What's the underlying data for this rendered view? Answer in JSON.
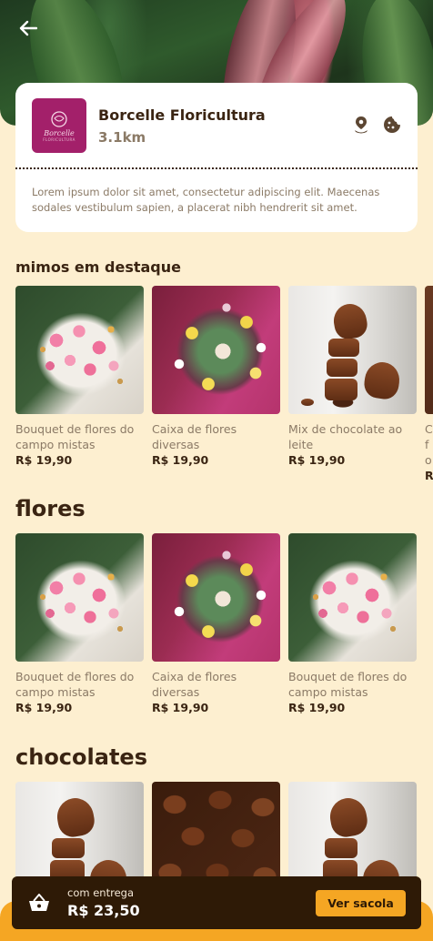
{
  "store": {
    "name": "Borcelle Floricultura",
    "distance": "3.1km",
    "logo_text": "Borcelle",
    "logo_sub": "FLORICULTURA",
    "description": "Lorem ipsum dolor sit amet, consectetur adipiscing elit. Maecenas sodales vestibulum sapien, a placerat nibh hendrerit sit amet."
  },
  "sections": {
    "featured": {
      "title": "mimos em destaque",
      "items": [
        {
          "name": "Bouquet de flores do campo mistas",
          "price": "R$ 19,90",
          "image": "bouquet"
        },
        {
          "name": "Caixa de flores diversas",
          "price": "R$ 19,90",
          "image": "flower-box"
        },
        {
          "name": "Mix de chocolate ao leite",
          "price": "R$ 19,90",
          "image": "chocolate-tower"
        },
        {
          "name": "C fo",
          "price": "R$",
          "image": "chocolate"
        }
      ]
    },
    "flowers": {
      "title": "flores",
      "items": [
        {
          "name": "Bouquet de flores do campo mistas",
          "price": "R$ 19,90",
          "image": "bouquet"
        },
        {
          "name": "Caixa de flores diversas",
          "price": "R$ 19,90",
          "image": "flower-box"
        },
        {
          "name": "Bouquet de flores do campo mistas",
          "price": "R$ 19,90",
          "image": "bouquet"
        }
      ]
    },
    "chocolates": {
      "title": "chocolates",
      "items": [
        {
          "image": "chocolate-tower"
        },
        {
          "image": "chocolate-hearts"
        },
        {
          "image": "chocolate-tower"
        }
      ]
    }
  },
  "cart": {
    "label": "com entrega",
    "total": "R$ 23,50",
    "button": "Ver sacola"
  },
  "colors": {
    "background": "#FDEFD0",
    "text_dark": "#3A2412",
    "text_muted": "#8B7A66",
    "accent": "#F5A623",
    "cart_bg": "#2E1A06",
    "logo_bg": "#A3206A"
  },
  "icons": [
    "back-arrow-icon",
    "location-pin-icon",
    "cookie-icon",
    "basket-icon"
  ]
}
